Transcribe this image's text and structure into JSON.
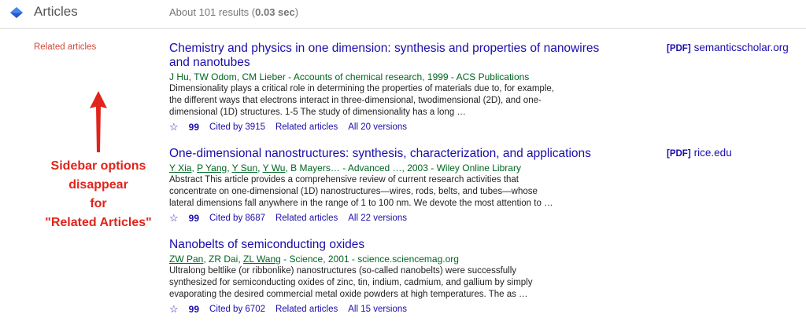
{
  "header": {
    "title": "Articles",
    "results_prefix": "About 101 results (",
    "results_time": "0.03 sec",
    "results_suffix": ")"
  },
  "sidebar": {
    "related_label": "Related articles"
  },
  "annotation": {
    "lines": [
      "Sidebar options",
      "disappear",
      "for",
      "\"Related Articles\""
    ]
  },
  "results": [
    {
      "title_line1": "Chemistry and physics in one dimension: synthesis and properties of nanowires",
      "title_line2": "and nanotubes",
      "meta": "J Hu, TW Odom, CM Lieber - Accounts of chemical research, 1999 - ACS Publications",
      "snippet": "Dimensionality plays a critical role in determining the properties of materials due to, for example, the different ways that electrons interact in three-dimensional, twodimensional (2D), and one-dimensional (1D) structures. 1-5 The study of dimensionality has a long …",
      "cited": "Cited by 3915",
      "related": "Related articles",
      "versions": "All 20 versions",
      "pdf_tag": "[PDF]",
      "pdf_source": "semanticscholar.org"
    },
    {
      "title_line1": "One-dimensional nanostructures: synthesis, characterization, and applications",
      "meta_authors": [
        "Y Xia",
        "P Yang",
        "Y Sun",
        "Y Wu"
      ],
      "meta_rest": "B Mayers… - Advanced …, 2003 - Wiley Online Library",
      "snippet": "Abstract This article provides a comprehensive review of current research activities that concentrate on one-dimensional (1D) nanostructures—wires, rods, belts, and tubes—whose lateral dimensions fall anywhere in the range of 1 to 100 nm. We devote the most attention to …",
      "cited": "Cited by 8687",
      "related": "Related articles",
      "versions": "All 22 versions",
      "pdf_tag": "[PDF]",
      "pdf_source": "rice.edu"
    },
    {
      "title_line1": "Nanobelts of semiconducting oxides",
      "meta_authors": [
        "ZW Pan",
        "ZL Wang"
      ],
      "meta_mid": "ZR Dai",
      "meta_rest": "- Science, 2001 - science.sciencemag.org",
      "snippet": "Ultralong beltlike (or ribbonlike) nanostructures (so-called nanobelts) were successfully synthesized for semiconducting oxides of zinc, tin, indium, cadmium, and gallium by simply evaporating the desired commercial metal oxide powders at high temperatures. The as …",
      "cited": "Cited by 6702",
      "related": "Related articles",
      "versions": "All 15 versions"
    }
  ],
  "icons": {
    "star": "star-icon",
    "quote": "cite-icon",
    "logo": "scholar-logo-icon"
  },
  "colors": {
    "link": "#1a0dab",
    "green": "#006621",
    "annotation": "#e0241b",
    "sidebar": "#d14836"
  }
}
